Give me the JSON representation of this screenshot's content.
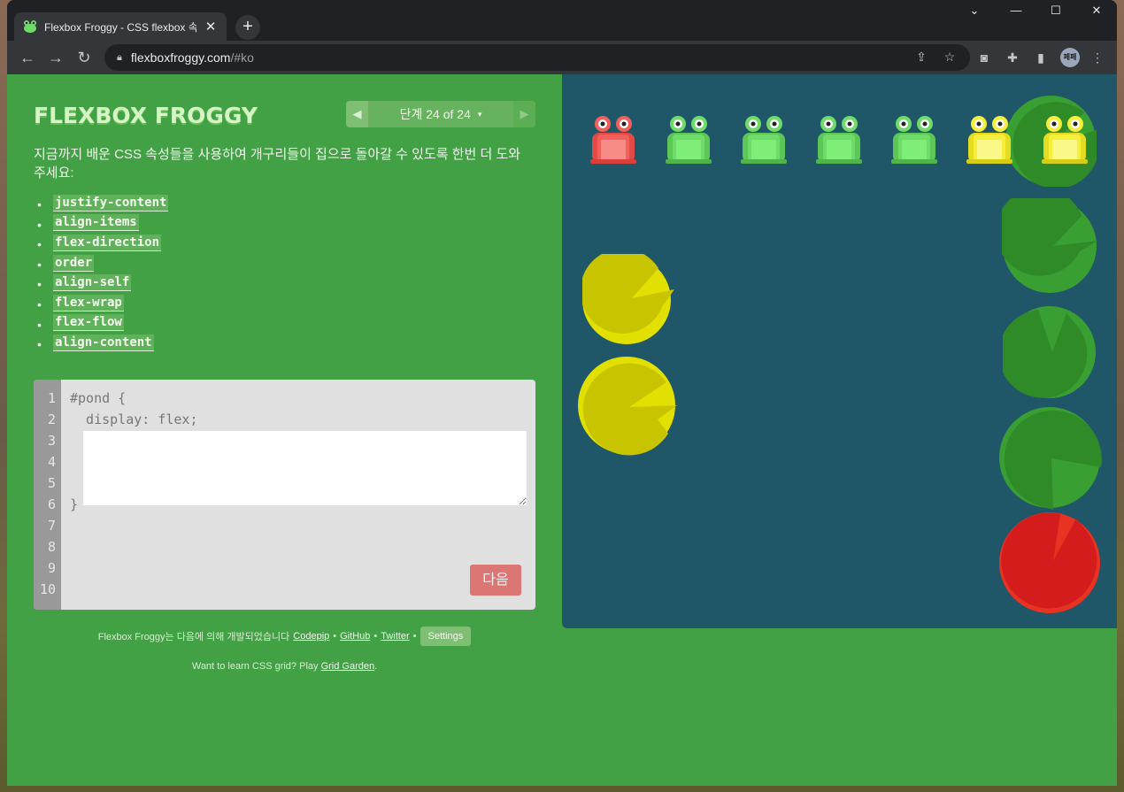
{
  "browser": {
    "tab_title": "Flexbox Froggy - CSS flexbox 속",
    "tab_close": "✕",
    "new_tab": "+",
    "url_domain": "flexboxfroggy.com",
    "url_path": "/#ko",
    "profile_initials": "페페"
  },
  "header": {
    "logo": "FLEXBOX FROGGY",
    "level_label": "단계 24 of 24",
    "level_caret": "▾"
  },
  "instructions": "지금까지 배운 CSS 속성들을 사용하여 개구리들이 집으로 돌아갈 수 있도록 한번 더 도와주세요:",
  "properties": [
    "justify-content",
    "align-items",
    "flex-direction",
    "order",
    "align-self",
    "flex-wrap",
    "flex-flow",
    "align-content"
  ],
  "editor": {
    "line_numbers": [
      "1",
      "2",
      "3",
      "4",
      "5",
      "6",
      "7",
      "8",
      "9",
      "10"
    ],
    "line1": "#pond {",
    "line2": "  display: flex;",
    "line6": "}",
    "input_value": "",
    "next_button": "다음"
  },
  "footer": {
    "credits_text": "Flexbox Froggy는 다음에 의해 개발되었습니다",
    "codepip": "Codepip",
    "github": "GitHub",
    "twitter": "Twitter",
    "separator": "•",
    "settings": "Settings",
    "grid_text": "Want to learn CSS grid? Play",
    "grid_link": "Grid Garden",
    "grid_end": "."
  },
  "pond": {
    "frogs": [
      "red",
      "green",
      "green",
      "green",
      "green",
      "yellow",
      "yellow"
    ],
    "lilypads": [
      "green",
      "green",
      "green",
      "green",
      "red",
      "yellow",
      "yellow"
    ]
  },
  "colors": {
    "page_bg": "#42a045",
    "pond_bg": "#1f5768",
    "frog_green": "#6fdc6a",
    "frog_red": "#f25f5c",
    "frog_yellow": "#f5ef3c",
    "pad_green": "#2e8b27",
    "pad_red": "#d41c1c",
    "pad_yellow": "#c8c400",
    "next_button": "#d9534f"
  }
}
